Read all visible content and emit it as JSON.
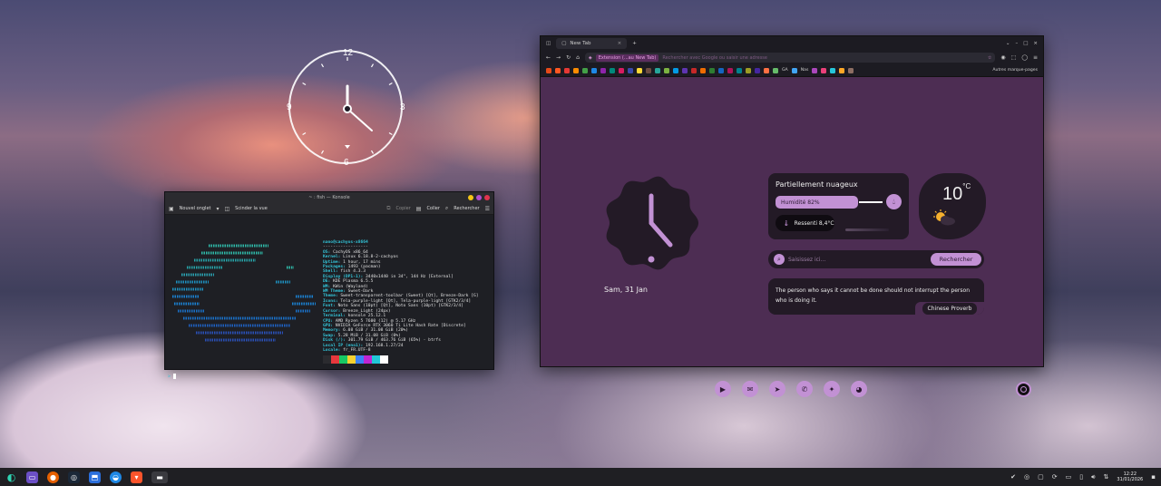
{
  "desktop_clock": {
    "n12": "12",
    "n3": "3",
    "n6": "6",
    "n9": "9"
  },
  "konsole": {
    "title": "~ : fish — Konsole",
    "toolbar": {
      "new_tab": "Nouvel onglet",
      "split": "Scinder la vue",
      "copy": "Copier",
      "paste": "Coller",
      "search": "Rechercher"
    },
    "header": "nano@cachyos-x8664",
    "separator": "------------------",
    "info": [
      {
        "k": "OS:",
        "v": " CachyOS x86_64"
      },
      {
        "k": "Kernel:",
        "v": " Linux 6.18.8-2-cachyos"
      },
      {
        "k": "Uptime:",
        "v": " 1 hour, 17 mins"
      },
      {
        "k": "Packages:",
        "v": " 1493 (pacman)"
      },
      {
        "k": "Shell:",
        "v": " fish 4.3.3"
      },
      {
        "k": "Display (DP1-1):",
        "v": " 3440x1440 in 34\", 144 Hz [External]"
      },
      {
        "k": "DE:",
        "v": " KDE Plasma 6.5.5"
      },
      {
        "k": "WM:",
        "v": " KWin (Wayland)"
      },
      {
        "k": "WM Theme:",
        "v": " Sweet-Dark"
      },
      {
        "k": "Theme:",
        "v": " Sweet-transparent-toolbar (Sweet) [Qt], Breeze-Dark [G]"
      },
      {
        "k": "Icons:",
        "v": " Tela-purple-light [Qt], Tela-purple-light [GTK2/3/4]"
      },
      {
        "k": "Font:",
        "v": " Noto Sans (10pt) [Qt], Noto Sans (10pt) [GTK2/3/4]"
      },
      {
        "k": "Cursor:",
        "v": " Breeze_Light (24px)"
      },
      {
        "k": "Terminal:",
        "v": " konsole 25.12.1"
      },
      {
        "k": "CPU:",
        "v": " AMD Ryzen 5 7600 (12) @ 5.17 GHz"
      },
      {
        "k": "GPU:",
        "v": " NVIDIA GeForce RTX 3060 Ti Lite Hash Rate [Discrete]"
      },
      {
        "k": "Memory:",
        "v": " 6.08 GiB / 31.08 GiB (20%)"
      },
      {
        "k": "Swap:",
        "v": " 5.28 MiB / 31.08 GiB (0%)"
      },
      {
        "k": "Disk (/):",
        "v": " 301.79 GiB / 463.76 GiB (65%) - btrfs"
      },
      {
        "k": "Local IP (eno1):",
        "v": " 192.168.1.27/24"
      },
      {
        "k": "Locale:",
        "v": " fr_FR.UTF-8"
      }
    ],
    "swatches": [
      "#2b2b2f",
      "#e8383d",
      "#18c964",
      "#f5d130",
      "#3b82f6",
      "#c026d3",
      "#22c7d8",
      "#ffffff"
    ],
    "prompt": ">"
  },
  "browser": {
    "tab_title": "New Tab",
    "url_pill": "Extension (...au New Tab)",
    "url_placeholder": "Rechercher avec Google ou saisir une adresse",
    "bookmarks_other": "Autres marque-pages",
    "bm_text1": "GA",
    "bm_text2": "Nas",
    "bookmark_colors": [
      "#e64a19",
      "#ff5722",
      "#e53935",
      "#fb8c00",
      "#43a047",
      "#1e88e5",
      "#8e24aa",
      "#00897b",
      "#d81b60",
      "#3949ab",
      "#fdd835",
      "#6d4c41",
      "#26a69a",
      "#7cb342",
      "#039be5",
      "#5e35b1",
      "#c62828",
      "#ef6c00",
      "#2e7d32",
      "#1565c0",
      "#ad1457",
      "#00838f",
      "#9e9d24",
      "#4527a0",
      "#ff7043",
      "#66bb6a",
      "#42a5f5",
      "#ab47bc",
      "#ec407a",
      "#26c6da",
      "#ffa726",
      "#8d6e63"
    ]
  },
  "newtab": {
    "date": "Sam, 31 Jan",
    "weather": {
      "condition": "Partiellement nuageux",
      "humidity": "Humidité 82%",
      "humidity_level": 0.82,
      "feels": "Ressenti 8,4°C",
      "temp": "10",
      "unit": "°C"
    },
    "search": {
      "placeholder": "Saisissez ici...",
      "button": "Rechercher"
    },
    "quote": {
      "text": "The person who says it cannot be done should not interrupt the person who is doing it.",
      "author": "Chinese Proverb"
    },
    "socials": [
      "youtube",
      "email",
      "telegram",
      "whatsapp",
      "twitter",
      "discord"
    ],
    "accent": "#c291d4",
    "page_bg": "#4d2d53",
    "card_bg": "#231a26"
  },
  "taskbar": {
    "time": "12:22",
    "date": "31/01/2026"
  }
}
